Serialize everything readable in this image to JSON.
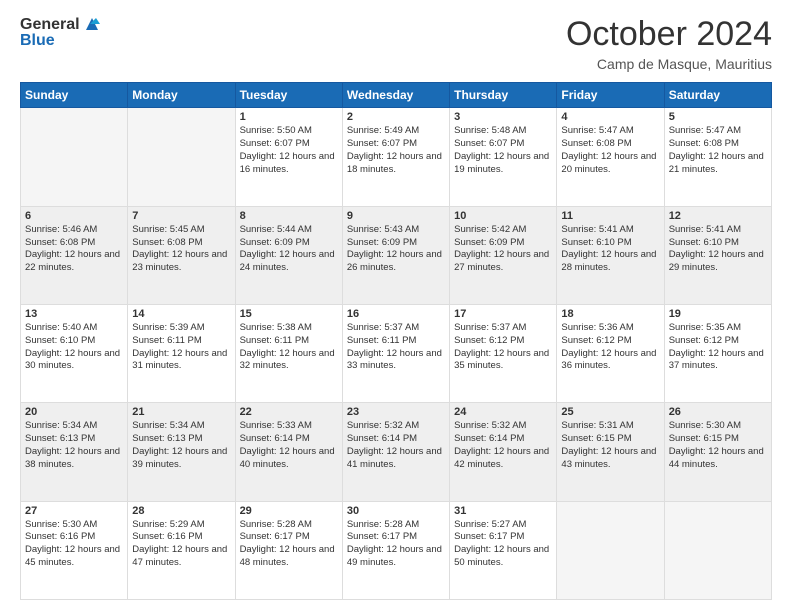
{
  "header": {
    "logo_general": "General",
    "logo_blue": "Blue",
    "month_title": "October 2024",
    "subtitle": "Camp de Masque, Mauritius"
  },
  "weekdays": [
    "Sunday",
    "Monday",
    "Tuesday",
    "Wednesday",
    "Thursday",
    "Friday",
    "Saturday"
  ],
  "weeks": [
    [
      {
        "day": "",
        "sunrise": "",
        "sunset": "",
        "daylight": ""
      },
      {
        "day": "",
        "sunrise": "",
        "sunset": "",
        "daylight": ""
      },
      {
        "day": "1",
        "sunrise": "Sunrise: 5:50 AM",
        "sunset": "Sunset: 6:07 PM",
        "daylight": "Daylight: 12 hours and 16 minutes."
      },
      {
        "day": "2",
        "sunrise": "Sunrise: 5:49 AM",
        "sunset": "Sunset: 6:07 PM",
        "daylight": "Daylight: 12 hours and 18 minutes."
      },
      {
        "day": "3",
        "sunrise": "Sunrise: 5:48 AM",
        "sunset": "Sunset: 6:07 PM",
        "daylight": "Daylight: 12 hours and 19 minutes."
      },
      {
        "day": "4",
        "sunrise": "Sunrise: 5:47 AM",
        "sunset": "Sunset: 6:08 PM",
        "daylight": "Daylight: 12 hours and 20 minutes."
      },
      {
        "day": "5",
        "sunrise": "Sunrise: 5:47 AM",
        "sunset": "Sunset: 6:08 PM",
        "daylight": "Daylight: 12 hours and 21 minutes."
      }
    ],
    [
      {
        "day": "6",
        "sunrise": "Sunrise: 5:46 AM",
        "sunset": "Sunset: 6:08 PM",
        "daylight": "Daylight: 12 hours and 22 minutes."
      },
      {
        "day": "7",
        "sunrise": "Sunrise: 5:45 AM",
        "sunset": "Sunset: 6:08 PM",
        "daylight": "Daylight: 12 hours and 23 minutes."
      },
      {
        "day": "8",
        "sunrise": "Sunrise: 5:44 AM",
        "sunset": "Sunset: 6:09 PM",
        "daylight": "Daylight: 12 hours and 24 minutes."
      },
      {
        "day": "9",
        "sunrise": "Sunrise: 5:43 AM",
        "sunset": "Sunset: 6:09 PM",
        "daylight": "Daylight: 12 hours and 26 minutes."
      },
      {
        "day": "10",
        "sunrise": "Sunrise: 5:42 AM",
        "sunset": "Sunset: 6:09 PM",
        "daylight": "Daylight: 12 hours and 27 minutes."
      },
      {
        "day": "11",
        "sunrise": "Sunrise: 5:41 AM",
        "sunset": "Sunset: 6:10 PM",
        "daylight": "Daylight: 12 hours and 28 minutes."
      },
      {
        "day": "12",
        "sunrise": "Sunrise: 5:41 AM",
        "sunset": "Sunset: 6:10 PM",
        "daylight": "Daylight: 12 hours and 29 minutes."
      }
    ],
    [
      {
        "day": "13",
        "sunrise": "Sunrise: 5:40 AM",
        "sunset": "Sunset: 6:10 PM",
        "daylight": "Daylight: 12 hours and 30 minutes."
      },
      {
        "day": "14",
        "sunrise": "Sunrise: 5:39 AM",
        "sunset": "Sunset: 6:11 PM",
        "daylight": "Daylight: 12 hours and 31 minutes."
      },
      {
        "day": "15",
        "sunrise": "Sunrise: 5:38 AM",
        "sunset": "Sunset: 6:11 PM",
        "daylight": "Daylight: 12 hours and 32 minutes."
      },
      {
        "day": "16",
        "sunrise": "Sunrise: 5:37 AM",
        "sunset": "Sunset: 6:11 PM",
        "daylight": "Daylight: 12 hours and 33 minutes."
      },
      {
        "day": "17",
        "sunrise": "Sunrise: 5:37 AM",
        "sunset": "Sunset: 6:12 PM",
        "daylight": "Daylight: 12 hours and 35 minutes."
      },
      {
        "day": "18",
        "sunrise": "Sunrise: 5:36 AM",
        "sunset": "Sunset: 6:12 PM",
        "daylight": "Daylight: 12 hours and 36 minutes."
      },
      {
        "day": "19",
        "sunrise": "Sunrise: 5:35 AM",
        "sunset": "Sunset: 6:12 PM",
        "daylight": "Daylight: 12 hours and 37 minutes."
      }
    ],
    [
      {
        "day": "20",
        "sunrise": "Sunrise: 5:34 AM",
        "sunset": "Sunset: 6:13 PM",
        "daylight": "Daylight: 12 hours and 38 minutes."
      },
      {
        "day": "21",
        "sunrise": "Sunrise: 5:34 AM",
        "sunset": "Sunset: 6:13 PM",
        "daylight": "Daylight: 12 hours and 39 minutes."
      },
      {
        "day": "22",
        "sunrise": "Sunrise: 5:33 AM",
        "sunset": "Sunset: 6:14 PM",
        "daylight": "Daylight: 12 hours and 40 minutes."
      },
      {
        "day": "23",
        "sunrise": "Sunrise: 5:32 AM",
        "sunset": "Sunset: 6:14 PM",
        "daylight": "Daylight: 12 hours and 41 minutes."
      },
      {
        "day": "24",
        "sunrise": "Sunrise: 5:32 AM",
        "sunset": "Sunset: 6:14 PM",
        "daylight": "Daylight: 12 hours and 42 minutes."
      },
      {
        "day": "25",
        "sunrise": "Sunrise: 5:31 AM",
        "sunset": "Sunset: 6:15 PM",
        "daylight": "Daylight: 12 hours and 43 minutes."
      },
      {
        "day": "26",
        "sunrise": "Sunrise: 5:30 AM",
        "sunset": "Sunset: 6:15 PM",
        "daylight": "Daylight: 12 hours and 44 minutes."
      }
    ],
    [
      {
        "day": "27",
        "sunrise": "Sunrise: 5:30 AM",
        "sunset": "Sunset: 6:16 PM",
        "daylight": "Daylight: 12 hours and 45 minutes."
      },
      {
        "day": "28",
        "sunrise": "Sunrise: 5:29 AM",
        "sunset": "Sunset: 6:16 PM",
        "daylight": "Daylight: 12 hours and 47 minutes."
      },
      {
        "day": "29",
        "sunrise": "Sunrise: 5:28 AM",
        "sunset": "Sunset: 6:17 PM",
        "daylight": "Daylight: 12 hours and 48 minutes."
      },
      {
        "day": "30",
        "sunrise": "Sunrise: 5:28 AM",
        "sunset": "Sunset: 6:17 PM",
        "daylight": "Daylight: 12 hours and 49 minutes."
      },
      {
        "day": "31",
        "sunrise": "Sunrise: 5:27 AM",
        "sunset": "Sunset: 6:17 PM",
        "daylight": "Daylight: 12 hours and 50 minutes."
      },
      {
        "day": "",
        "sunrise": "",
        "sunset": "",
        "daylight": ""
      },
      {
        "day": "",
        "sunrise": "",
        "sunset": "",
        "daylight": ""
      }
    ]
  ]
}
